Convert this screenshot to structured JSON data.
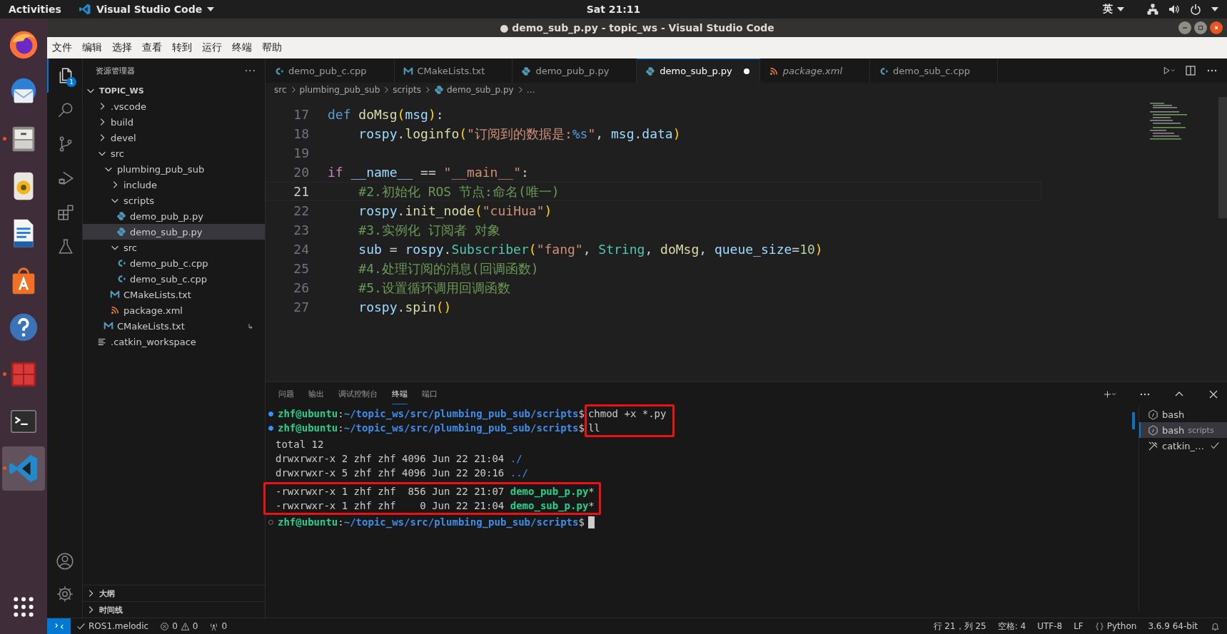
{
  "topbar": {
    "activities": "Activities",
    "app": "Visual Studio Code",
    "clock": "Sat 21:11",
    "input_method": "英"
  },
  "dock": [
    {
      "kind": "firefox",
      "running": false,
      "selected": false
    },
    {
      "kind": "mail",
      "running": false,
      "selected": false
    },
    {
      "kind": "files",
      "running": true,
      "selected": false
    },
    {
      "kind": "music",
      "running": false,
      "selected": false
    },
    {
      "kind": "writer",
      "running": false,
      "selected": false
    },
    {
      "kind": "store",
      "running": false,
      "selected": false
    },
    {
      "kind": "help",
      "running": false,
      "selected": false
    },
    {
      "kind": "remote",
      "running": true,
      "selected": false
    },
    {
      "kind": "terminal",
      "running": false,
      "selected": false
    },
    {
      "kind": "vscode",
      "running": true,
      "selected": true
    }
  ],
  "window": {
    "title": "● demo_sub_p.py - topic_ws - Visual Studio Code"
  },
  "menu": [
    "文件",
    "编辑",
    "选择",
    "查看",
    "转到",
    "运行",
    "终端",
    "帮助"
  ],
  "activity_bar": [
    {
      "kind": "explorer",
      "selected": true,
      "badge": "1"
    },
    {
      "kind": "search",
      "selected": false
    },
    {
      "kind": "scm",
      "selected": false
    },
    {
      "kind": "debug",
      "selected": false
    },
    {
      "kind": "extensions",
      "selected": false
    },
    {
      "kind": "testing",
      "selected": false
    }
  ],
  "sidebar": {
    "title": "资源管理器",
    "more": "···",
    "root": {
      "label": "TOPIC_WS",
      "expanded": true
    },
    "tree": [
      {
        "label": ".vscode",
        "kind": "folder",
        "expanded": false,
        "selected": false
      },
      {
        "label": "build",
        "kind": "folder",
        "expanded": false,
        "selected": false
      },
      {
        "label": "devel",
        "kind": "folder",
        "expanded": false,
        "selected": false
      },
      {
        "label": "src",
        "kind": "folder",
        "expanded": true,
        "selected": false,
        "children": [
          {
            "label": "plumbing_pub_sub",
            "kind": "folder",
            "expanded": true,
            "selected": false,
            "children": [
              {
                "label": "include",
                "kind": "folder",
                "expanded": false,
                "selected": false
              },
              {
                "label": "scripts",
                "kind": "folder",
                "expanded": true,
                "selected": false,
                "children": [
                  {
                    "label": "demo_pub_p.py",
                    "kind": "python",
                    "selected": false
                  },
                  {
                    "label": "demo_sub_p.py",
                    "kind": "python",
                    "selected": true
                  }
                ]
              },
              {
                "label": "src",
                "kind": "folder",
                "expanded": true,
                "selected": false,
                "children": [
                  {
                    "label": "demo_pub_c.cpp",
                    "kind": "cpp",
                    "selected": false
                  },
                  {
                    "label": "demo_sub_c.cpp",
                    "kind": "cpp",
                    "selected": false
                  }
                ]
              },
              {
                "label": "CMakeLists.txt",
                "kind": "cmake",
                "selected": false
              },
              {
                "label": "package.xml",
                "kind": "xml",
                "selected": false
              }
            ]
          },
          {
            "label": "CMakeLists.txt",
            "kind": "cmake",
            "selected": false,
            "decoration": "↳"
          }
        ]
      },
      {
        "label": ".catkin_workspace",
        "kind": "text",
        "selected": false
      }
    ],
    "sections": [
      {
        "label": "大纲",
        "expanded": false
      },
      {
        "label": "时间线",
        "expanded": false
      }
    ]
  },
  "tabs": [
    {
      "label": "demo_pub_c.cpp",
      "kind": "cpp",
      "selected": false,
      "modified": false,
      "preview": false
    },
    {
      "label": "CMakeLists.txt",
      "kind": "cmake",
      "selected": false,
      "modified": false,
      "preview": false
    },
    {
      "label": "demo_pub_p.py",
      "kind": "python",
      "selected": false,
      "modified": false,
      "preview": false
    },
    {
      "label": "demo_sub_p.py",
      "kind": "python",
      "selected": true,
      "modified": true,
      "preview": false
    },
    {
      "label": "package.xml",
      "kind": "xml",
      "selected": false,
      "modified": false,
      "preview": true
    },
    {
      "label": "demo_sub_c.cpp",
      "kind": "cpp",
      "selected": false,
      "modified": false,
      "preview": false
    }
  ],
  "breadcrumbs": [
    {
      "label": "src",
      "kind": "folder"
    },
    {
      "label": "plumbing_pub_sub",
      "kind": "folder"
    },
    {
      "label": "scripts",
      "kind": "folder"
    },
    {
      "label": "demo_sub_p.py",
      "kind": "python"
    },
    {
      "label": "…",
      "kind": "folder"
    }
  ],
  "code": [
    {
      "number": "17",
      "current": false,
      "tokens": [
        {
          "text": "def",
          "kind": "kw"
        },
        {
          "text": " doMsg",
          "kind": "fn"
        },
        {
          "text": "(",
          "kind": "bracket"
        },
        {
          "text": "msg",
          "kind": "var"
        },
        {
          "text": ")",
          "kind": "bracket"
        },
        {
          "text": ":",
          "kind": "punc"
        }
      ]
    },
    {
      "number": "18",
      "current": false,
      "tokens": [
        {
          "text": "    rospy",
          "kind": "var"
        },
        {
          "text": ".",
          "kind": "punc"
        },
        {
          "text": "loginfo",
          "kind": "fn"
        },
        {
          "text": "(",
          "kind": "bracket"
        },
        {
          "text": "\"订阅到的数据是:",
          "kind": "str"
        },
        {
          "text": "%s",
          "kind": "kw"
        },
        {
          "text": "\"",
          "kind": "str"
        },
        {
          "text": ", ",
          "kind": "punc"
        },
        {
          "text": "msg",
          "kind": "var"
        },
        {
          "text": ".",
          "kind": "punc"
        },
        {
          "text": "data",
          "kind": "var"
        },
        {
          "text": ")",
          "kind": "bracket"
        }
      ]
    },
    {
      "number": "19",
      "current": false
    },
    {
      "number": "20",
      "current": false,
      "tokens": [
        {
          "text": "if",
          "kind": "ctrl"
        },
        {
          "text": " __name__",
          "kind": "var"
        },
        {
          "text": " == ",
          "kind": "punc"
        },
        {
          "text": "\"__main__\"",
          "kind": "str"
        },
        {
          "text": ":",
          "kind": "punc"
        }
      ]
    },
    {
      "number": "21",
      "current": true,
      "tokens": [
        {
          "text": "    #2.初始化 ROS 节点:命名(唯一)",
          "kind": "cm"
        }
      ]
    },
    {
      "number": "22",
      "current": false,
      "tokens": [
        {
          "text": "    rospy",
          "kind": "var"
        },
        {
          "text": ".",
          "kind": "punc"
        },
        {
          "text": "init_node",
          "kind": "fn"
        },
        {
          "text": "(",
          "kind": "bracket"
        },
        {
          "text": "\"cuiHua\"",
          "kind": "str"
        },
        {
          "text": ")",
          "kind": "bracket"
        }
      ]
    },
    {
      "number": "23",
      "current": false,
      "tokens": [
        {
          "text": "    #3.实例化 订阅者 对象",
          "kind": "cm"
        }
      ]
    },
    {
      "number": "24",
      "current": false,
      "tokens": [
        {
          "text": "    sub",
          "kind": "var"
        },
        {
          "text": " = ",
          "kind": "punc"
        },
        {
          "text": "rospy",
          "kind": "var"
        },
        {
          "text": ".",
          "kind": "punc"
        },
        {
          "text": "Subscriber",
          "kind": "cls"
        },
        {
          "text": "(",
          "kind": "bracket"
        },
        {
          "text": "\"fang\"",
          "kind": "str"
        },
        {
          "text": ", ",
          "kind": "punc"
        },
        {
          "text": "String",
          "kind": "cls"
        },
        {
          "text": ", ",
          "kind": "punc"
        },
        {
          "text": "doMsg",
          "kind": "fn"
        },
        {
          "text": ", ",
          "kind": "punc"
        },
        {
          "text": "queue_size",
          "kind": "var"
        },
        {
          "text": "=",
          "kind": "punc"
        },
        {
          "text": "10",
          "kind": "num"
        },
        {
          "text": ")",
          "kind": "bracket"
        }
      ]
    },
    {
      "number": "25",
      "current": false,
      "tokens": [
        {
          "text": "    #4.处理订阅的消息(回调函数)",
          "kind": "cm"
        }
      ]
    },
    {
      "number": "26",
      "current": false,
      "tokens": [
        {
          "text": "    #5.设置循环调用回调函数",
          "kind": "cm"
        }
      ]
    },
    {
      "number": "27",
      "current": false,
      "tokens": [
        {
          "text": "    rospy",
          "kind": "var"
        },
        {
          "text": ".",
          "kind": "punc"
        },
        {
          "text": "spin",
          "kind": "fn"
        },
        {
          "text": "()",
          "kind": "bracket"
        }
      ]
    }
  ],
  "panel": {
    "tabs": [
      {
        "label": "问题",
        "selected": false
      },
      {
        "label": "输出",
        "selected": false
      },
      {
        "label": "调试控制台",
        "selected": false
      },
      {
        "label": "终端",
        "selected": true
      },
      {
        "label": "端口",
        "selected": false
      }
    ],
    "terminal": [
      {
        "kind": "prompts",
        "boxed": true,
        "entries": [
          {
            "user": "zhf@ubuntu",
            "sep": ":",
            "path": "~/topic_ws/src/plumbing_pub_sub/scripts",
            "dollar": "$",
            "command": "chmod +x *.py",
            "done": true
          },
          {
            "user": "zhf@ubuntu",
            "sep": ":",
            "path": "~/topic_ws/src/plumbing_pub_sub/scripts",
            "dollar": "$",
            "command": "ll",
            "done": true
          }
        ]
      },
      {
        "kind": "output",
        "boxed": false,
        "lines": [
          [
            {
              "text": "total 12",
              "kind": "plain"
            }
          ],
          [
            {
              "text": "drwxrwxr-x 2 zhf zhf 4096 Jun 22 21:04 ",
              "kind": "plain"
            },
            {
              "text": "./",
              "kind": "dir"
            }
          ],
          [
            {
              "text": "drwxrwxr-x 5 zhf zhf 4096 Jun 22 20:16 ",
              "kind": "plain"
            },
            {
              "text": "../",
              "kind": "dir"
            }
          ]
        ]
      },
      {
        "kind": "output",
        "boxed": true,
        "lines": [
          [
            {
              "text": "-rwxrwxr-x 1 zhf zhf  856 Jun 22 21:07 ",
              "kind": "plain"
            },
            {
              "text": "demo_pub_p.py",
              "kind": "exe"
            },
            {
              "text": "*",
              "kind": "plain"
            }
          ],
          [
            {
              "text": "-rwxrwxr-x 1 zhf zhf    0 Jun 22 21:04 ",
              "kind": "plain"
            },
            {
              "text": "demo_sub_p.py",
              "kind": "exe"
            },
            {
              "text": "*",
              "kind": "plain"
            }
          ]
        ]
      },
      {
        "kind": "prompts",
        "boxed": false,
        "entries": [
          {
            "user": "zhf@ubuntu",
            "sep": ":",
            "path": "~/topic_ws/src/plumbing_pub_sub/scripts",
            "dollar": "$",
            "done": false,
            "cursor": true
          }
        ]
      }
    ],
    "sessions": [
      {
        "label": "bash",
        "kind": "shell",
        "selected": false,
        "done": false
      },
      {
        "label": "bash",
        "detail": "scripts",
        "kind": "shell",
        "selected": true,
        "done": false
      },
      {
        "label": "catkin_…",
        "kind": "task",
        "selected": false,
        "done": true
      }
    ]
  },
  "status_bar": {
    "profile": "ROS1.melodic",
    "errors": "0",
    "warnings": "0",
    "ports": "0",
    "right": [
      {
        "text": "行 21，列 25",
        "kind": "text"
      },
      {
        "text": "空格: 4",
        "kind": "text"
      },
      {
        "text": "UTF-8",
        "kind": "text"
      },
      {
        "text": "LF",
        "kind": "text"
      },
      {
        "text": "Python",
        "kind": "language"
      },
      {
        "text": "3.6.9 64-bit",
        "kind": "text"
      }
    ]
  }
}
